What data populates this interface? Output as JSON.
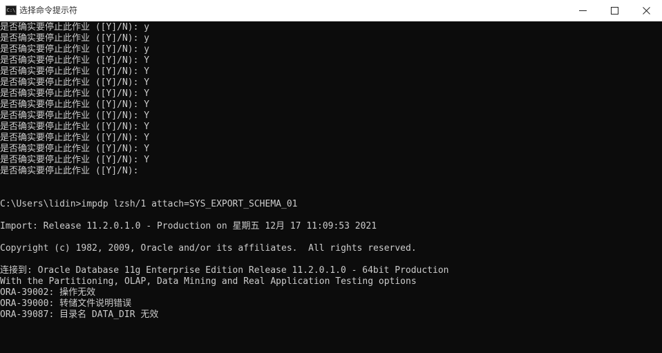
{
  "window": {
    "title": "选择命令提示符",
    "icon": "C:\\",
    "controls": [
      "minimize-icon",
      "maximize-icon",
      "close-icon"
    ]
  },
  "console": {
    "lines": [
      "是否确实要停止此作业 ([Y]/N): y",
      "是否确实要停止此作业 ([Y]/N): y",
      "是否确实要停止此作业 ([Y]/N): y",
      "是否确实要停止此作业 ([Y]/N): Y",
      "是否确实要停止此作业 ([Y]/N): Y",
      "是否确实要停止此作业 ([Y]/N): Y",
      "是否确实要停止此作业 ([Y]/N): Y",
      "是否确实要停止此作业 ([Y]/N): Y",
      "是否确实要停止此作业 ([Y]/N): Y",
      "是否确实要停止此作业 ([Y]/N): Y",
      "是否确实要停止此作业 ([Y]/N): Y",
      "是否确实要停止此作业 ([Y]/N): Y",
      "是否确实要停止此作业 ([Y]/N): Y",
      "是否确实要停止此作业 ([Y]/N):",
      "",
      "",
      "C:\\Users\\lidin>impdp lzsh/1 attach=SYS_EXPORT_SCHEMA_01",
      "",
      "Import: Release 11.2.0.1.0 - Production on 星期五 12月 17 11:09:53 2021",
      "",
      "Copyright (c) 1982, 2009, Oracle and/or its affiliates.  All rights reserved.",
      "",
      "连接到: Oracle Database 11g Enterprise Edition Release 11.2.0.1.0 - 64bit Production",
      "With the Partitioning, OLAP, Data Mining and Real Application Testing options",
      "ORA-39002: 操作无效",
      "ORA-39000: 转储文件说明错误",
      "ORA-39087: 目录名 DATA_DIR 无效"
    ]
  }
}
